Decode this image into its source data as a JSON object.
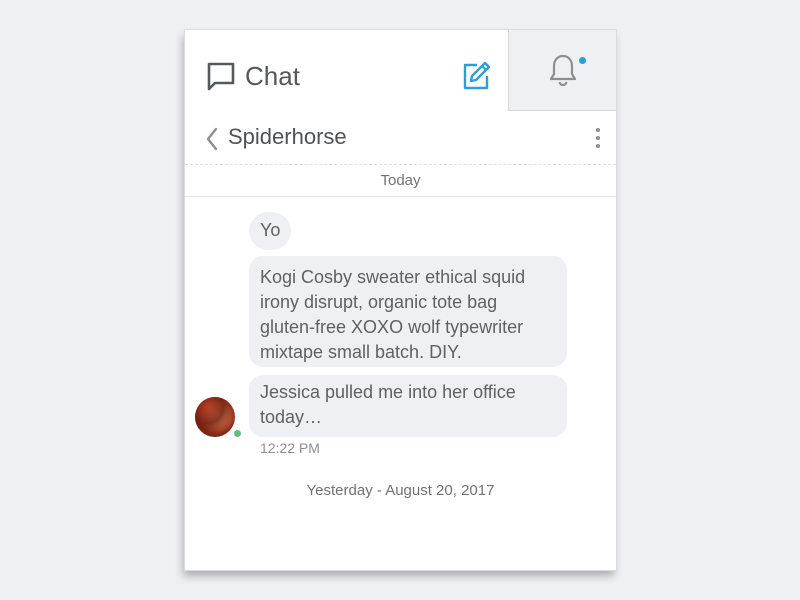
{
  "header": {
    "title": "Chat",
    "chat_icon": "chat-bubble-icon",
    "compose_icon": "compose-icon",
    "notifications_icon": "bell-icon",
    "notification_indicator": true
  },
  "conversation": {
    "name": "Spiderhorse",
    "back_icon": "chevron-left-icon",
    "more_icon": "more-vertical-icon"
  },
  "messages": {
    "date_divider": "Today",
    "items": [
      {
        "text": "Yo"
      },
      {
        "text": "Kogi Cosby sweater ethical squid\nirony disrupt, organic tote bag\ngluten-free XOXO wolf typewriter\nmixtape small batch. DIY."
      },
      {
        "text": "Jessica pulled me into her office\ntoday…"
      }
    ],
    "sender_status": "online",
    "time": "12:22 PM",
    "next_date_divider": "Yesterday - August 20, 2017"
  },
  "colors": {
    "accent": "#2a9fd8",
    "online": "#5fc07e",
    "bubble": "#eef0f3",
    "background": "#eef0f3"
  }
}
